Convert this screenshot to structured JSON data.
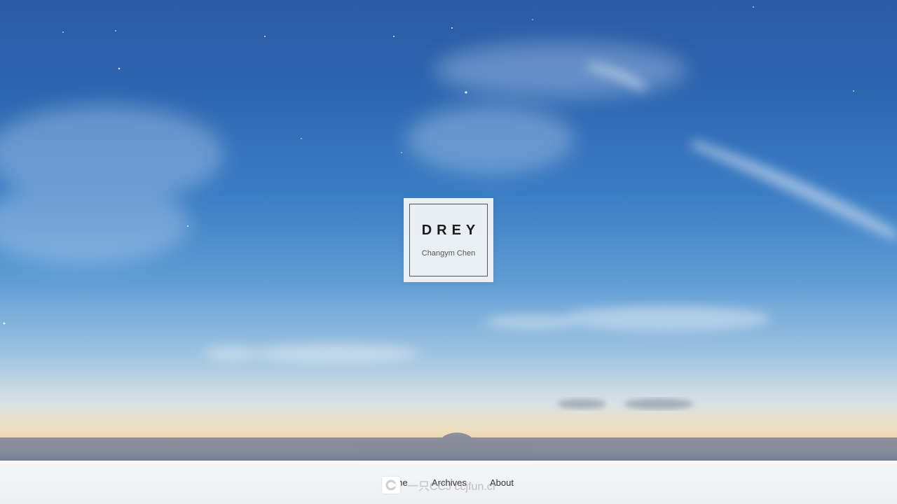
{
  "site": {
    "title": "DREY",
    "subtitle": "Changym Chen"
  },
  "nav": {
    "items": [
      {
        "label": "Home"
      },
      {
        "label": "Archives"
      },
      {
        "label": "About"
      }
    ]
  },
  "watermark": {
    "text": "一只CCJ  ccjfun.cf",
    "icon": "camera-logo-icon"
  },
  "colors": {
    "sky_top": "#2c5aa4",
    "sky_mid": "#5d9bd3",
    "horizon_glow": "#efdcb8",
    "nav_bg": "#f4f5f6",
    "card_bg": "#f0f3f6",
    "title_text": "#1c1c1c"
  }
}
